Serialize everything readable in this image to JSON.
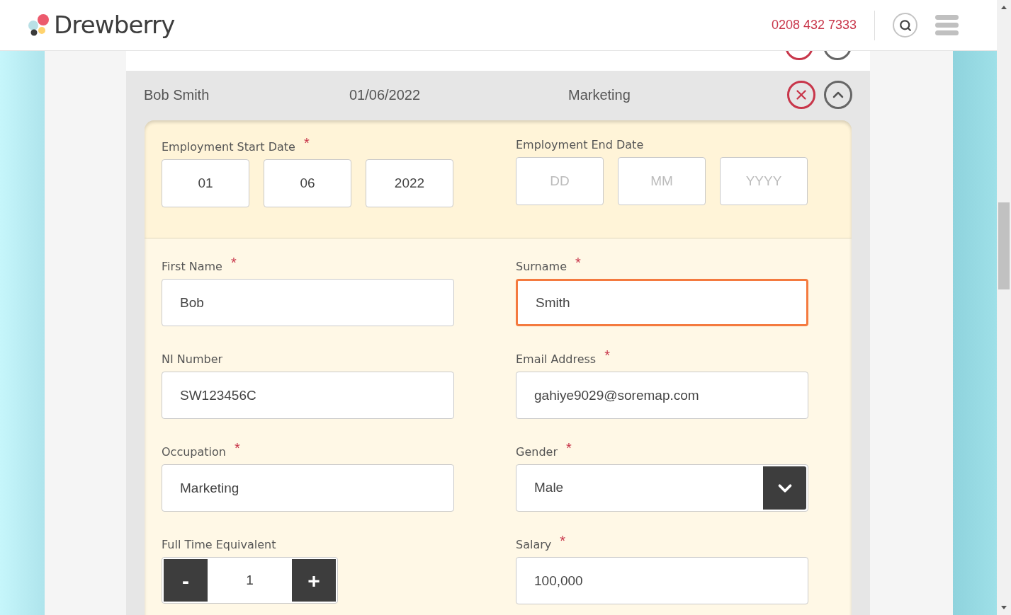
{
  "header": {
    "logo": "Drewberry",
    "phone": "0208 432 7333"
  },
  "employee_row": {
    "name": "Bob Smith",
    "date": "01/06/2022",
    "department": "Marketing",
    "expanded": true
  },
  "date_fields": [
    {
      "label": "Employment Start Date",
      "required": true,
      "parts": [
        {
          "value": "01"
        },
        {
          "value": "06"
        },
        {
          "value": "2022"
        }
      ]
    },
    {
      "label": "Employment End Date",
      "required": false,
      "parts": [
        {
          "placeholder": "DD"
        },
        {
          "placeholder": "MM"
        },
        {
          "placeholder": "YYYY"
        }
      ]
    }
  ],
  "fields": [
    {
      "kind": "text",
      "label": "First Name",
      "required": true,
      "value": "Bob",
      "focused": false
    },
    {
      "kind": "text",
      "label": "Surname",
      "required": true,
      "value": "Smith",
      "focused": true
    },
    {
      "kind": "text",
      "label": "NI Number",
      "required": false,
      "value": "SW123456C",
      "focused": false
    },
    {
      "kind": "text",
      "label": "Email Address",
      "required": true,
      "value": "gahiye9029@soremap.com",
      "focused": false
    },
    {
      "kind": "text",
      "label": "Occupation",
      "required": true,
      "value": "Marketing",
      "focused": false
    },
    {
      "kind": "select",
      "label": "Gender",
      "required": true,
      "value": "Male",
      "focused": false
    },
    {
      "kind": "stepper",
      "label": "Full Time Equivalent",
      "required": false,
      "value": "1",
      "minus": "-",
      "plus": "+",
      "focused": false
    },
    {
      "kind": "text",
      "label": "Salary",
      "required": true,
      "value": "100,000",
      "focused": false
    }
  ],
  "required_mark": "*"
}
